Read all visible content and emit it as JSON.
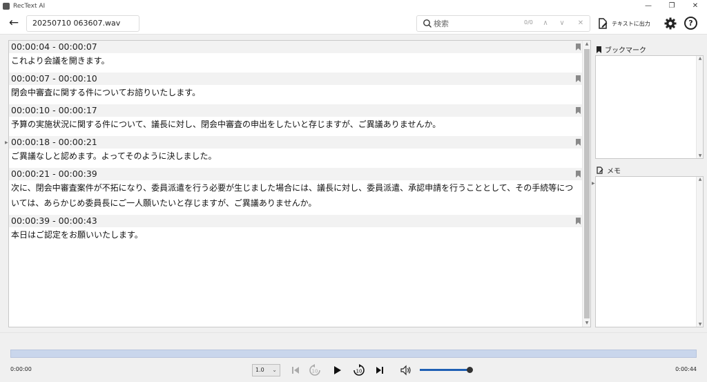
{
  "window": {
    "title": "RecText AI",
    "minimize": "—",
    "restore": "❐",
    "close": "✕"
  },
  "toolbar": {
    "back_label": "←",
    "file_name": "20250710 063607.wav",
    "search_placeholder": "検索",
    "search_count": "0/0",
    "search_prev": "∧",
    "search_next": "∨",
    "search_clear": "✕",
    "export_label": "テキストに出力",
    "help_label": "?"
  },
  "transcript": {
    "segments": [
      {
        "time": "00:00:04 - 00:00:07",
        "text": "これより会議を開きます。"
      },
      {
        "time": "00:00:07 - 00:00:10",
        "text": "閉会中審査に関する件についてお諮りいたします。"
      },
      {
        "time": "00:00:10 - 00:00:17",
        "text": "予算の実施状況に関する件について、議長に対し、閉会中審査の申出をしたいと存じますが、ご異議ありませんか。"
      },
      {
        "time": "00:00:18 - 00:00:21",
        "text": "ご異議なしと認めます。よってそのように決しました。"
      },
      {
        "time": "00:00:21 - 00:00:39",
        "text": "次に、閉会中審査案件が不拓になり、委員派遣を行う必要が生じました場合には、議長に対し、委員派遣、承認申請を行うこととして、その手続等については、あらかじめ委員長にご一人願いたいと存じますが、ご異議ありませんか。"
      },
      {
        "time": "00:00:39 - 00:00:43",
        "text": "本日はご認定をお願いいたします。"
      }
    ]
  },
  "sidebar": {
    "bookmark_label": "ブックマーク",
    "memo_label": "メモ"
  },
  "player": {
    "current_time": "0:00:00",
    "total_time": "0:00:44",
    "speed": "1.0",
    "volume_level": 0.95
  },
  "colors": {
    "seekbar": "#c9d6ec",
    "volume": "#1e5fb4"
  }
}
